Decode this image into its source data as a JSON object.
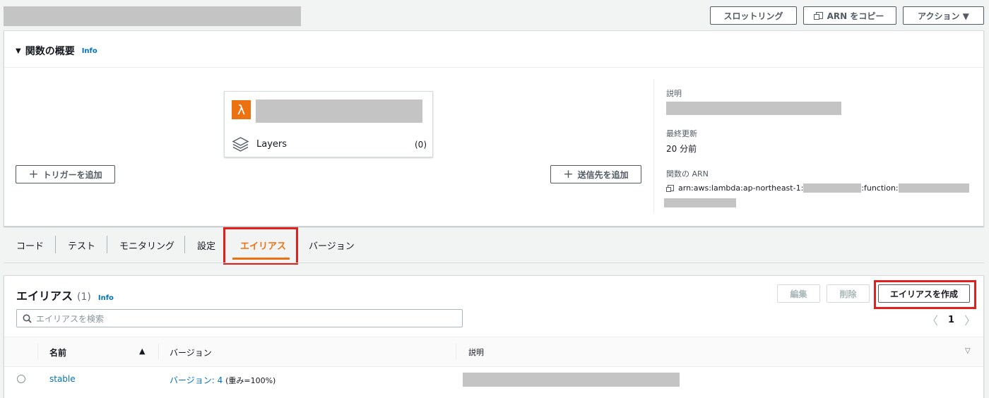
{
  "header": {
    "throttle_label": "スロットリング",
    "copy_arn_label": "ARN をコピー",
    "actions_label": "アクション ▼"
  },
  "overview": {
    "title": "関数の概要",
    "info": "Info",
    "layers_label": "Layers",
    "layers_count": "(0)",
    "add_trigger_label": "トリガーを追加",
    "add_destination_label": "送信先を追加",
    "description_label": "説明",
    "last_modified_label": "最終更新",
    "last_modified_value": "20 分前",
    "arn_label": "関数の ARN",
    "arn_part1": "arn:aws:lambda:ap-northeast-1:",
    "arn_part2": ":function:"
  },
  "tabs": [
    "コード",
    "テスト",
    "モニタリング",
    "設定",
    "エイリアス",
    "バージョン"
  ],
  "aliases": {
    "title": "エイリアス",
    "count": "(1)",
    "info": "Info",
    "edit_label": "編集",
    "delete_label": "削除",
    "create_label": "エイリアスを作成",
    "search_placeholder": "エイリアスを検索",
    "page": "1",
    "columns": {
      "name": "名前",
      "version": "バージョン",
      "description": "説明"
    },
    "rows": [
      {
        "name": "stable",
        "version": "バージョン: 4",
        "weight": "(重み=100%)"
      }
    ]
  },
  "colors": {
    "accent": "#ec7211",
    "link": "#0073bb",
    "highlight": "#e0201d"
  }
}
